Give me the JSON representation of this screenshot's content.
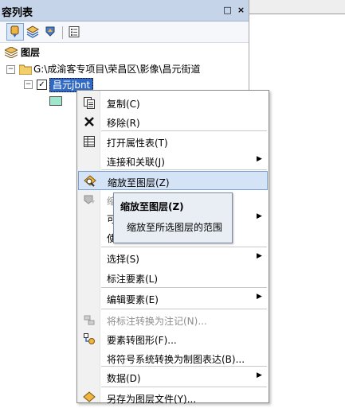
{
  "panel": {
    "title": "容列表",
    "pin_glyph": "□",
    "close_glyph": "×"
  },
  "toolbar": {
    "buttons": [
      {
        "name": "list-by-drawing-order-icon"
      },
      {
        "name": "list-by-source-icon"
      },
      {
        "name": "list-by-visibility-icon"
      },
      {
        "name": "options-icon"
      }
    ]
  },
  "tree": {
    "root_label": "图层",
    "folder_label": "G:\\成渝客专项目\\荣昌区\\影像\\昌元街道",
    "layer_label": "昌元jbnt",
    "expander_glyph": "−",
    "check_glyph": "✓",
    "legend_color": "#9ee6cc"
  },
  "context_menu": {
    "items": [
      {
        "label": "复制(C)",
        "icon": "copy-icon",
        "disabled": false,
        "submenu": false
      },
      {
        "label": "移除(R)",
        "icon": "remove-icon",
        "disabled": false,
        "submenu": false
      },
      {
        "label": "打开属性表(T)",
        "icon": "table-icon",
        "disabled": false,
        "submenu": false
      },
      {
        "label": "连接和关联(J)",
        "icon": "",
        "disabled": false,
        "submenu": true
      },
      {
        "label": "缩放至图层(Z)",
        "icon": "zoom-to-layer-icon",
        "disabled": false,
        "submenu": false,
        "highlighted": true
      },
      {
        "label": "缩",
        "icon": "zoom-visible-icon",
        "disabled": true,
        "submenu": false
      },
      {
        "label": "可",
        "icon": "",
        "disabled": false,
        "submenu": true
      },
      {
        "label": "使",
        "icon": "",
        "disabled": false,
        "submenu": false
      },
      {
        "label": "选择(S)",
        "icon": "",
        "disabled": false,
        "submenu": true
      },
      {
        "label": "标注要素(L)",
        "icon": "",
        "disabled": false,
        "submenu": false
      },
      {
        "label": "编辑要素(E)",
        "icon": "",
        "disabled": false,
        "submenu": true
      },
      {
        "label": "将标注转换为注记(N)...",
        "icon": "convert-labels-icon",
        "disabled": true,
        "submenu": false
      },
      {
        "label": "要素转图形(F)...",
        "icon": "features-to-graphics-icon",
        "disabled": false,
        "submenu": false
      },
      {
        "label": "将符号系统转换为制图表达(B)...",
        "icon": "",
        "disabled": false,
        "submenu": false
      },
      {
        "label": "数据(D)",
        "icon": "",
        "disabled": false,
        "submenu": true
      },
      {
        "label": "另存为图层文件(Y)...",
        "icon": "save-layer-icon",
        "disabled": false,
        "submenu": false
      }
    ],
    "submenu_arrow": "▶"
  },
  "tooltip": {
    "title": "缩放至图层(Z)",
    "description": "缩放至所选图层的范围"
  },
  "colors": {
    "title_bar": "#c5d4e8",
    "selection": "#316ac5",
    "menu_highlight": "#d5e3f7"
  }
}
